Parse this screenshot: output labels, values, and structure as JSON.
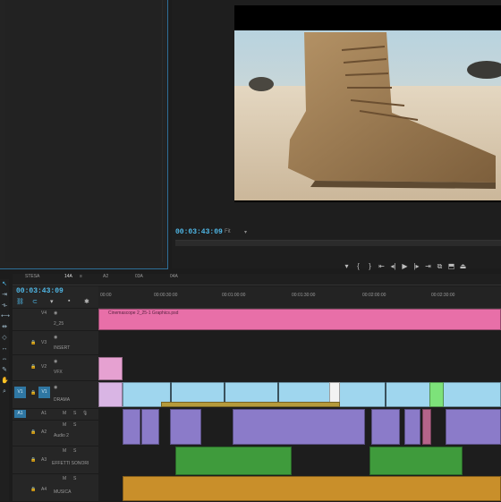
{
  "program_monitor": {
    "timecode": "00:03:43:09",
    "fit_label": "Fit"
  },
  "timeline": {
    "tabs": [
      "STESA",
      "14A",
      "A2",
      "03A",
      "04A"
    ],
    "timecode": "00:03:43:09",
    "ruler_times": [
      "00:00",
      "00:00:30:00",
      "00:01:00:00",
      "00:01:30:00",
      "00:02:00:00",
      "00:02:30:00"
    ],
    "tracks": [
      {
        "id": "V4",
        "name": "2_25"
      },
      {
        "id": "V3",
        "name": "INSERT"
      },
      {
        "id": "V2",
        "name": "VFX"
      },
      {
        "id": "V1",
        "name": "DRAMA",
        "src": "V1"
      },
      {
        "id": "A1",
        "name": "",
        "src": "A1"
      },
      {
        "id": "A2",
        "name": "Audio 2"
      },
      {
        "id": "A3",
        "name": "EFFETTI SONORI"
      },
      {
        "id": "A4",
        "name": "MUSICA"
      }
    ],
    "pink_clip_label": "Cinemascope 2_25-1 Graphics.psd"
  },
  "colors": {
    "accent": "#4fb7e6",
    "pink_clip": "#e86fa8",
    "video_clip": "#9fd6ee",
    "audio_clip": "#8b7bc9",
    "sfx_clip": "#3f9b3c",
    "music_clip": "#c98f2a"
  }
}
